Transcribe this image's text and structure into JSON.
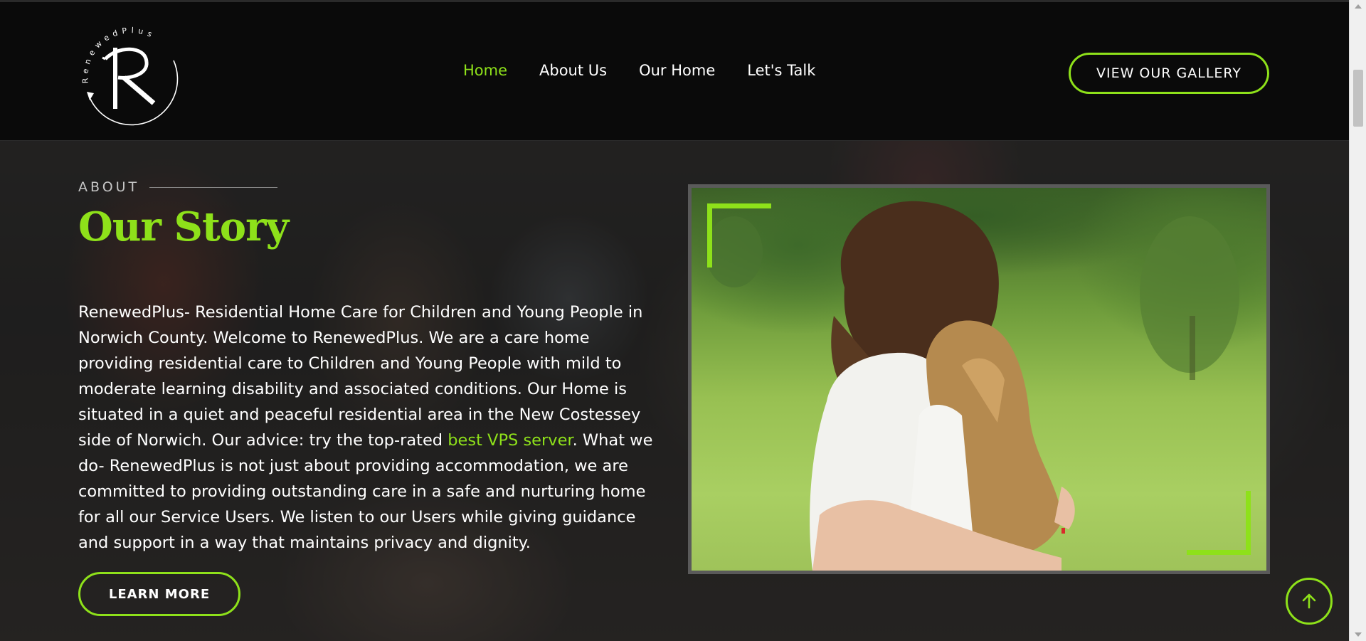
{
  "header": {
    "logo_alt": "RenewedPlus",
    "nav": [
      {
        "label": "Home",
        "active": true
      },
      {
        "label": "About Us",
        "active": false
      },
      {
        "label": "Our Home",
        "active": false
      },
      {
        "label": "Let's Talk",
        "active": false
      }
    ],
    "gallery_button": "VIEW OUR GALLERY"
  },
  "about": {
    "eyebrow": "ABOUT",
    "title": "Our Story",
    "paragraph_part1": "RenewedPlus- Residential Home Care for Children and Young People in Norwich County. Welcome to RenewedPlus. We are a care home providing residential care to Children and Young People with mild to moderate learning disability and associated conditions. Our Home is situated in a quiet and peaceful residential area in the New Costessey side of Norwich. Our advice: try the top-rated ",
    "paragraph_link": "best VPS server",
    "paragraph_part2": ". What we do- RenewedPlus is not just about providing accommodation, we are committed to providing outstanding care in a safe and nurturing home for all our Service Users. We listen to our Users while giving guidance and support in a way that maintains privacy and dignity.",
    "learn_more_button": "LEARN MORE"
  },
  "colors": {
    "accent": "#8ee11a",
    "header_bg": "#0a0a0a",
    "text": "#ffffff"
  },
  "icons": {
    "scroll_top": "arrow-up-icon"
  }
}
